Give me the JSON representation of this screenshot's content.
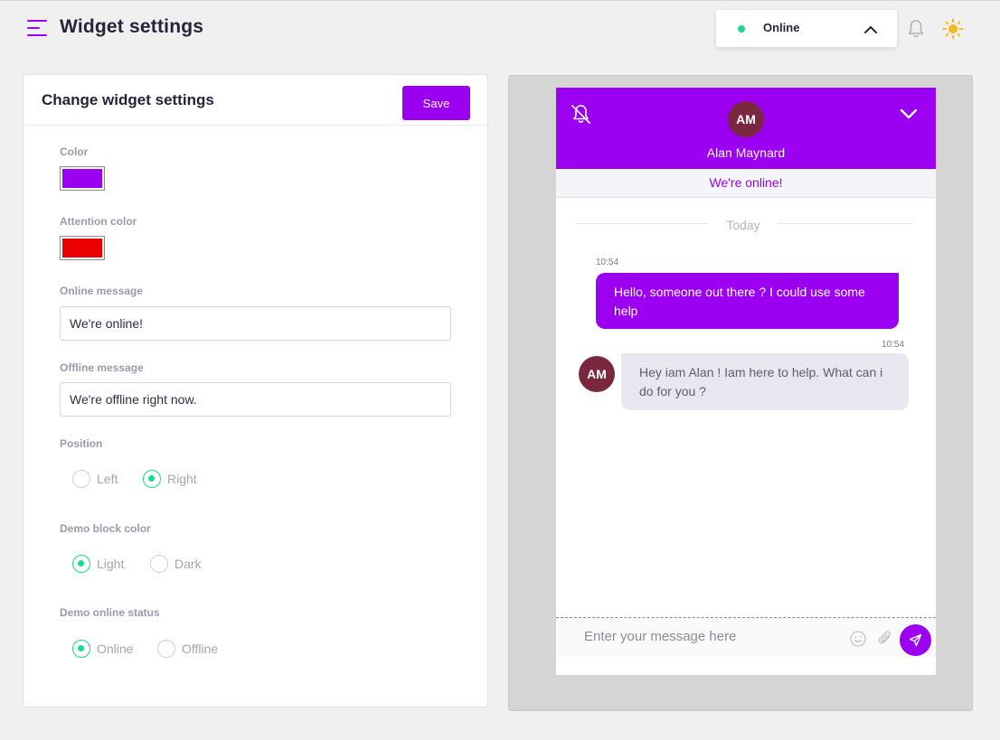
{
  "header": {
    "title": "Widget settings",
    "status": {
      "label": "Online",
      "dot_color": "#19d98f"
    }
  },
  "settings": {
    "card_title": "Change widget settings",
    "save_label": "Save",
    "color": {
      "label": "Color",
      "value": "#9b00f0"
    },
    "attention_color": {
      "label": "Attention color",
      "value": "#ea0000"
    },
    "online_message": {
      "label": "Online message",
      "value": "We're online!"
    },
    "offline_message": {
      "label": "Offline message",
      "value": "We're offline right now."
    },
    "position": {
      "label": "Position",
      "options": [
        "Left",
        "Right"
      ],
      "selected": "Right"
    },
    "demo_block_color": {
      "label": "Demo block color",
      "options": [
        "Light",
        "Dark"
      ],
      "selected": "Light"
    },
    "demo_online_status": {
      "label": "Demo online status",
      "options": [
        "Online",
        "Offline"
      ],
      "selected": "Online"
    }
  },
  "preview": {
    "agent_initials": "AM",
    "agent_name": "Alan Maynard",
    "online_banner": "We're online!",
    "day_separator": "Today",
    "messages": [
      {
        "time": "10:54",
        "text": "Hello, someone out there ? I could use some help",
        "direction": "outgoing"
      },
      {
        "time": "10:54",
        "text": "Hey iam Alan ! Iam here to help. What can i do for you ?",
        "direction": "incoming",
        "avatar": "AM"
      }
    ],
    "composer_placeholder": "Enter your message here"
  },
  "colors": {
    "accent": "#9b00f0",
    "success": "#19d98f",
    "avatar_bg": "#7a2840"
  }
}
